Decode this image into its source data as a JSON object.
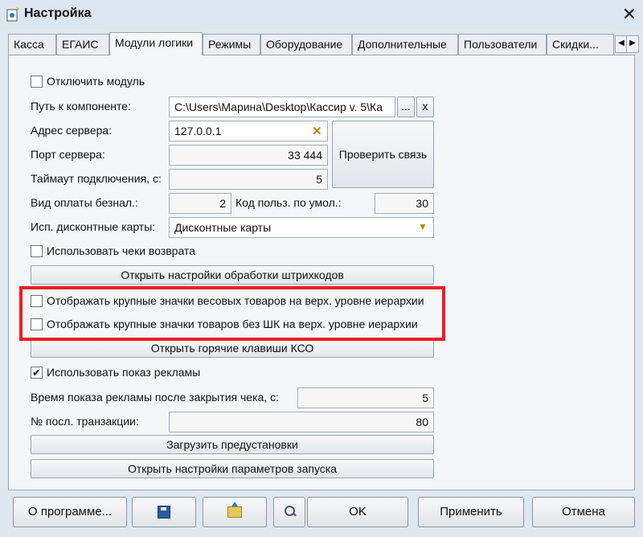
{
  "window": {
    "title": "Настройка",
    "close_glyph": "✕",
    "icon": "settings-app-icon"
  },
  "tabs": [
    {
      "label": "Касса"
    },
    {
      "label": "ЕГАИС"
    },
    {
      "label": "Модули логики",
      "active": true
    },
    {
      "label": "Режимы"
    },
    {
      "label": "Оборудование"
    },
    {
      "label": "Дополнительные"
    },
    {
      "label": "Пользователи"
    },
    {
      "label": "Скидки..."
    }
  ],
  "tab_scroll": {
    "left": "◀",
    "right": "▶"
  },
  "form": {
    "disable_module": {
      "label": "Отключить модуль",
      "checked": false
    },
    "component_path": {
      "label": "Путь к компоненте:",
      "value": "C:\\Users\\Марина\\Desktop\\Кассир v. 5\\Ка",
      "browse_label": "...",
      "clear_label": "x"
    },
    "server_address": {
      "label": "Адрес сервера:",
      "value": "127.0.0.1",
      "clear_glyph": "✕"
    },
    "check_connection_label": "Проверить связь",
    "server_port": {
      "label": "Порт сервера:",
      "value": "33 444"
    },
    "timeout": {
      "label": "Таймаут подключения, с:",
      "value": "5"
    },
    "cashless_type": {
      "label": "Вид оплаты безнал.:",
      "value": "2"
    },
    "default_user_code": {
      "label": "Код польз. по умол.:",
      "value": "30"
    },
    "discount_cards": {
      "label": "Исп. дисконтные карты:",
      "value": "Дисконтные карты",
      "arrow": "▼"
    },
    "use_return_receipts": {
      "label": "Использовать чеки возврата",
      "checked": false
    },
    "open_barcode_settings_label": "Открыть настройки обработки штрихкодов",
    "large_weight_icons": {
      "label": "Отображать крупные значки весовых товаров на верх. уровне иерархии",
      "checked": false
    },
    "large_nobarcode_icons": {
      "label": "Отображать крупные значки товаров без ШК на верх. уровне иерархии",
      "checked": false
    },
    "open_hotkeys_label": "Открыть горячие клавиши КСО",
    "use_ads": {
      "label": "Использовать показ рекламы",
      "checked": true,
      "check_glyph": "✔"
    },
    "ad_time": {
      "label": "Время показа рекламы после закрытия чека, с:",
      "value": "5"
    },
    "last_transaction": {
      "label": "№ посл. транзакции:",
      "value": "80"
    },
    "load_presets_label": "Загрузить предустановки",
    "open_launch_settings_label": "Открыть настройки параметров запуска"
  },
  "footer": {
    "about_label": "О программе...",
    "save_icon": "floppy-disk-icon",
    "open_icon": "folder-open-icon",
    "search_icon": "search-icon",
    "ok_label": "OK",
    "apply_label": "Применить",
    "cancel_label": "Отмена"
  },
  "colors": {
    "highlight": "#ee1c25",
    "window_bg": "#dfe7ef",
    "panel_bg": "#f4f6f8"
  }
}
